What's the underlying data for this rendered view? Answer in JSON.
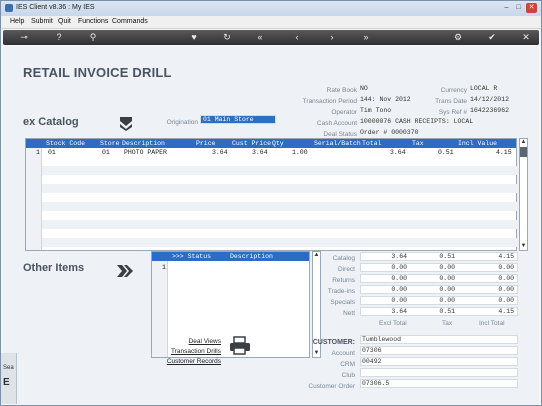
{
  "window": {
    "title": "IES Client v8.36 : My IES"
  },
  "menu": {
    "items": [
      "Help",
      "Submit",
      "Quit",
      "Functions",
      "Commands"
    ]
  },
  "toolbar": {
    "icons": [
      "key-icon",
      "help-icon",
      "search-icon",
      "heart-icon",
      "refresh-icon",
      "rewind-icon",
      "back-icon",
      "forward-icon",
      "fast-forward-icon",
      "settings-icon",
      "confirm-icon",
      "close-icon"
    ]
  },
  "page": {
    "title": "RETAIL INVOICE  DRILL"
  },
  "header": {
    "rate_book": {
      "label": "Rate Book",
      "value": "NO"
    },
    "transaction_period": {
      "label": "Transaction Period",
      "value": "144: Nov 2012"
    },
    "operator": {
      "label": "Operator",
      "value": "Tim Tono"
    },
    "cash_account": {
      "label": "Cash Account",
      "value": "10000076 CASH RECEIPTS: LOCAL"
    },
    "deal_status": {
      "label": "Deal Status",
      "value": "Order # 0000370"
    },
    "currency": {
      "label": "Currency",
      "value": "LOCAL R"
    },
    "trans_date": {
      "label": "Trans Date",
      "value": "14/12/2012"
    },
    "sys_ref": {
      "label": "Sys Ref #",
      "value": "1642236962"
    },
    "origination": {
      "label": "Origination",
      "value": "01 Main Store"
    }
  },
  "ex_catalog": {
    "heading": "ex Catalog",
    "columns": [
      "Stock Code",
      "Store",
      "Description",
      "Price",
      "Cust Price",
      "Qty",
      "Serial/Batch",
      "Total",
      "Tax",
      "Incl Value"
    ],
    "rows": [
      {
        "num": "1",
        "stock_code": "01",
        "store": "01",
        "description": "PHOTO PAPER",
        "price": "3.64",
        "cust_price": "3.64",
        "qty": "1.00",
        "serial": "",
        "total": "3.64",
        "tax": "0.51",
        "incl": "4.15"
      }
    ]
  },
  "other_items": {
    "heading": "Other Items",
    "columns": [
      ">>> Status",
      "Description"
    ],
    "rows": [
      {
        "num": "1",
        "status": "",
        "description": ""
      }
    ]
  },
  "totals": {
    "rows": [
      {
        "label": "Catalog",
        "excl": "3.64",
        "tax": "0.51",
        "incl": "4.15"
      },
      {
        "label": "Direct",
        "excl": "0.00",
        "tax": "0.00",
        "incl": "0.00"
      },
      {
        "label": "Returns",
        "excl": "0.00",
        "tax": "0.00",
        "incl": "0.00"
      },
      {
        "label": "Trade-ins",
        "excl": "0.00",
        "tax": "0.00",
        "incl": "0.00"
      },
      {
        "label": "Specials",
        "excl": "0.00",
        "tax": "0.00",
        "incl": "0.00"
      },
      {
        "label": "Nett",
        "excl": "3.64",
        "tax": "0.51",
        "incl": "4.15"
      }
    ],
    "footer": [
      "Excl Total",
      "Tax",
      "Incl Total"
    ]
  },
  "links": [
    "Deal Views",
    "Transaction Drills",
    "Customer Records"
  ],
  "customer": {
    "heading": "CUSTOMER:",
    "name": "Tumblewood",
    "account": {
      "label": "Account",
      "value": "07306"
    },
    "crm": {
      "label": "CRM",
      "value": "00492"
    },
    "club": {
      "label": "Club",
      "value": ""
    },
    "customer_order": {
      "label": "Customer Order",
      "value": "07306.5"
    }
  },
  "left_edge": {
    "text": "Sea"
  }
}
